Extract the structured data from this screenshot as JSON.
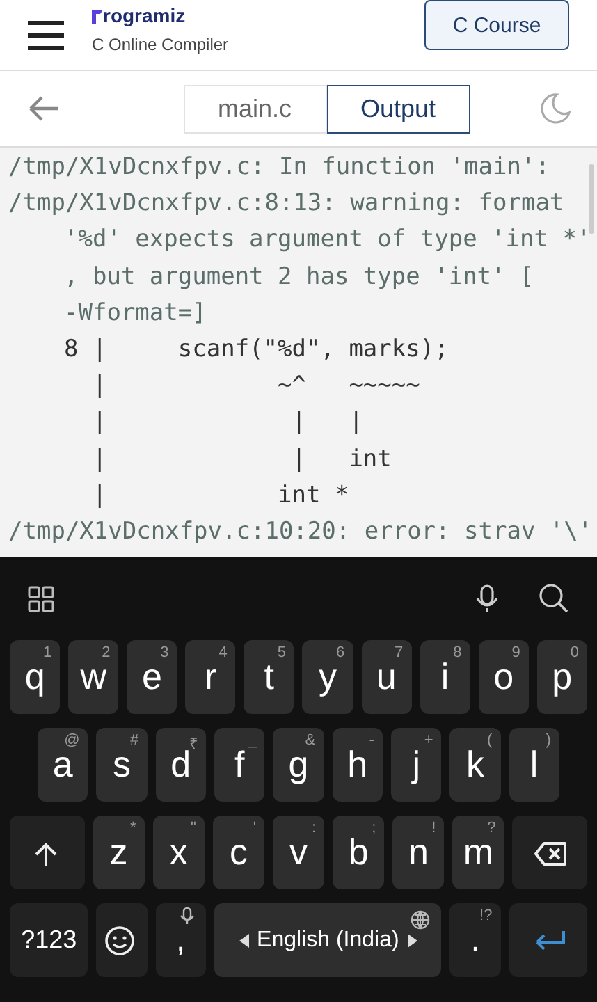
{
  "header": {
    "logo": "rogramiz",
    "subtitle": "C Online Compiler",
    "course_button": "C Course"
  },
  "tabs": [
    {
      "label": "main.c",
      "selected": false
    },
    {
      "label": "Output",
      "selected": true
    }
  ],
  "output": {
    "lines": [
      {
        "text": "/tmp/X1vDcnxfpv.c: In function 'main':",
        "indented": false
      },
      {
        "text": "/tmp/X1vDcnxfpv.c:8:13: warning: format",
        "indented": false
      },
      {
        "text": "'%d' expects argument of type 'int *'",
        "indented": true
      },
      {
        "text": ", but argument 2 has type 'int' [",
        "indented": true
      },
      {
        "text": "-Wformat=]",
        "indented": true
      },
      {
        "text": "8 |     scanf(\"%d\", marks);",
        "indented": true
      },
      {
        "text": "  |            ~^   ~~~~~",
        "indented": true
      },
      {
        "text": "  |             |   |",
        "indented": true
      },
      {
        "text": "  |             |   int",
        "indented": true
      },
      {
        "text": "  |            int *",
        "indented": true
      },
      {
        "text": "/tmp/X1vDcnxfpv.c:10:20: error: strav '\\'",
        "indented": false
      }
    ]
  },
  "keyboard": {
    "rows": [
      {
        "keys": [
          {
            "kind": "letter",
            "label": "q",
            "hint": "1"
          },
          {
            "kind": "letter",
            "label": "w",
            "hint": "2"
          },
          {
            "kind": "letter",
            "label": "e",
            "hint": "3"
          },
          {
            "kind": "letter",
            "label": "r",
            "hint": "4"
          },
          {
            "kind": "letter",
            "label": "t",
            "hint": "5"
          },
          {
            "kind": "letter",
            "label": "y",
            "hint": "6"
          },
          {
            "kind": "letter",
            "label": "u",
            "hint": "7"
          },
          {
            "kind": "letter",
            "label": "i",
            "hint": "8"
          },
          {
            "kind": "letter",
            "label": "o",
            "hint": "9"
          },
          {
            "kind": "letter",
            "label": "p",
            "hint": "0"
          }
        ]
      },
      {
        "keys": [
          {
            "kind": "letter",
            "label": "a",
            "hint": "@"
          },
          {
            "kind": "letter",
            "label": "s",
            "hint": "#"
          },
          {
            "kind": "letter",
            "label": "d",
            "hint": "₹"
          },
          {
            "kind": "letter",
            "label": "f",
            "hint": "_"
          },
          {
            "kind": "letter",
            "label": "g",
            "hint": "&"
          },
          {
            "kind": "letter",
            "label": "h",
            "hint": "-"
          },
          {
            "kind": "letter",
            "label": "j",
            "hint": "+"
          },
          {
            "kind": "letter",
            "label": "k",
            "hint": "("
          },
          {
            "kind": "letter",
            "label": "l",
            "hint": ")"
          }
        ]
      },
      {
        "keys": [
          {
            "kind": "shift"
          },
          {
            "kind": "letter",
            "label": "z",
            "hint": "*"
          },
          {
            "kind": "letter",
            "label": "x",
            "hint": "\""
          },
          {
            "kind": "letter",
            "label": "c",
            "hint": "'"
          },
          {
            "kind": "letter",
            "label": "v",
            "hint": ":"
          },
          {
            "kind": "letter",
            "label": "b",
            "hint": ";"
          },
          {
            "kind": "letter",
            "label": "n",
            "hint": "!"
          },
          {
            "kind": "letter",
            "label": "m",
            "hint": "?"
          },
          {
            "kind": "backspace"
          }
        ]
      },
      {
        "keys": [
          {
            "kind": "symbols",
            "label": "?123"
          },
          {
            "kind": "emoji"
          },
          {
            "kind": "comma",
            "label": ","
          },
          {
            "kind": "space",
            "label": "English (India)"
          },
          {
            "kind": "period",
            "label": ".",
            "hint": "!?"
          },
          {
            "kind": "enter"
          }
        ]
      }
    ]
  }
}
